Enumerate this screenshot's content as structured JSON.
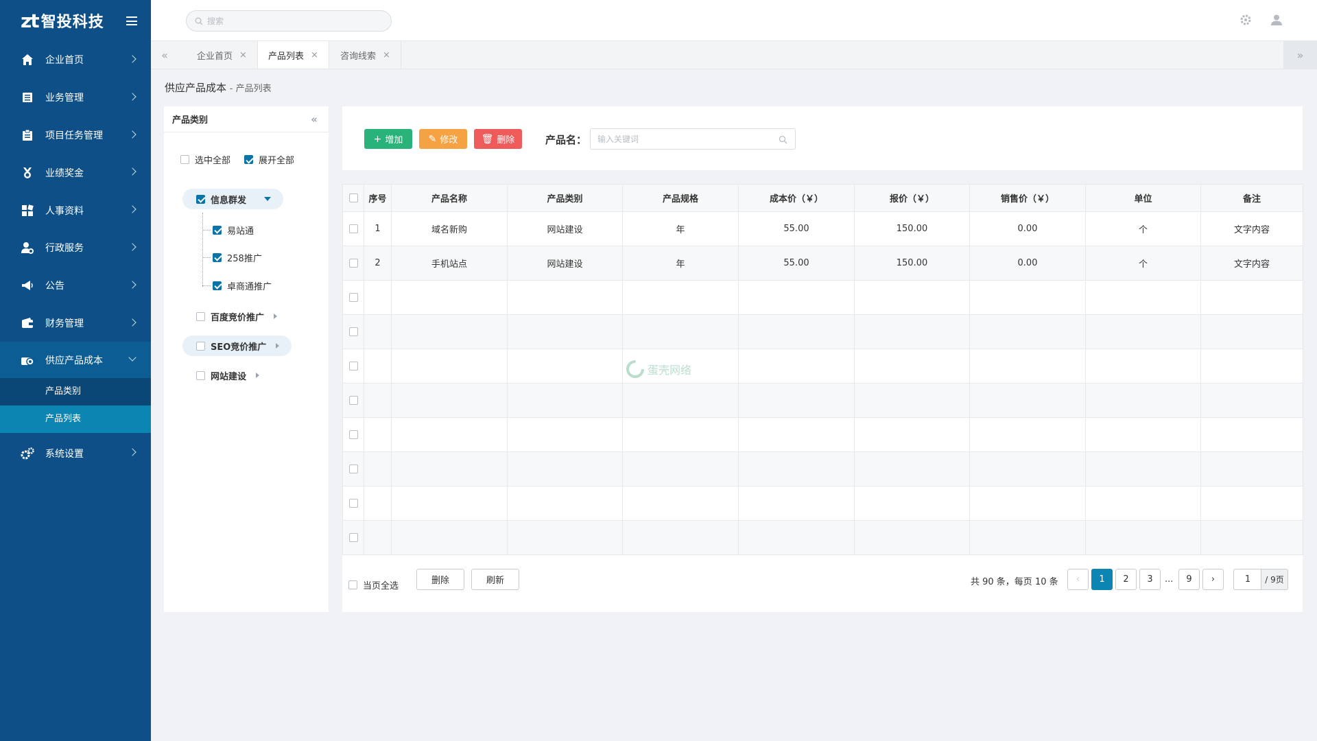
{
  "brand": {
    "mark": "zt",
    "name": "智投科技"
  },
  "sidebar": {
    "items": [
      {
        "label": "企业首页",
        "icon": "home-icon"
      },
      {
        "label": "业务管理",
        "icon": "list-icon"
      },
      {
        "label": "项目任务管理",
        "icon": "clipboard-icon"
      },
      {
        "label": "业绩奖金",
        "icon": "medal-icon"
      },
      {
        "label": "人事资料",
        "icon": "grid-icon"
      },
      {
        "label": "行政服务",
        "icon": "user-gear-icon"
      },
      {
        "label": "公告",
        "icon": "megaphone-icon"
      },
      {
        "label": "财务管理",
        "icon": "wallet-icon"
      },
      {
        "label": "供应产品成本",
        "icon": "cost-icon"
      },
      {
        "label": "系统设置",
        "icon": "gears-icon"
      }
    ],
    "sub_items": [
      {
        "label": "产品类别"
      },
      {
        "label": "产品列表"
      }
    ]
  },
  "search": {
    "placeholder": "搜索"
  },
  "tabs": [
    {
      "label": "企业首页",
      "close": "×"
    },
    {
      "label": "产品列表",
      "close": "×"
    },
    {
      "label": "咨询线索",
      "close": "×"
    }
  ],
  "breadcrumb": {
    "main": "供应产品成本",
    "sub": "- 产品列表"
  },
  "tree": {
    "title": "产品类别",
    "select_all": "选中全部",
    "expand_all": "展开全部",
    "nodes": [
      {
        "label": "信息群发"
      },
      {
        "label": "易站通"
      },
      {
        "label": "258推广"
      },
      {
        "label": "卓商通推广"
      },
      {
        "label": "百度竞价推广"
      },
      {
        "label": "SEO竞价推广"
      },
      {
        "label": "网站建设"
      }
    ]
  },
  "toolbar": {
    "add": "增加",
    "edit": "修改",
    "delete": "删除",
    "field_label": "产品名：",
    "field_placeholder": "输入关键词"
  },
  "table": {
    "headers": [
      "序号",
      "产品名称",
      "产品类别",
      "产品规格",
      "成本价（￥）",
      "报价（￥）",
      "销售价（￥）",
      "单位",
      "备注"
    ],
    "rows": [
      [
        "1",
        "域名新购",
        "网站建设",
        "年",
        "55.00",
        "150.00",
        "0.00",
        "个",
        "文字内容"
      ],
      [
        "2",
        "手机站点",
        "网站建设",
        "年",
        "55.00",
        "150.00",
        "0.00",
        "个",
        "文字内容"
      ]
    ]
  },
  "footer": {
    "select_page": "当页全选",
    "delete": "删除",
    "refresh": "刷新",
    "summary": "共 90 条，每页 10 条",
    "prev": "‹",
    "next": "›",
    "pages": [
      "1",
      "2",
      "3",
      "...",
      "9"
    ],
    "current_page": "1",
    "total_pages": "/ 9页"
  },
  "watermark": "蛋壳网络",
  "colors": {
    "sidebar": "#0d4f86",
    "active": "#0d85b3",
    "add": "#2ab27b",
    "edit": "#f5a243",
    "delete": "#ef5a5a"
  }
}
